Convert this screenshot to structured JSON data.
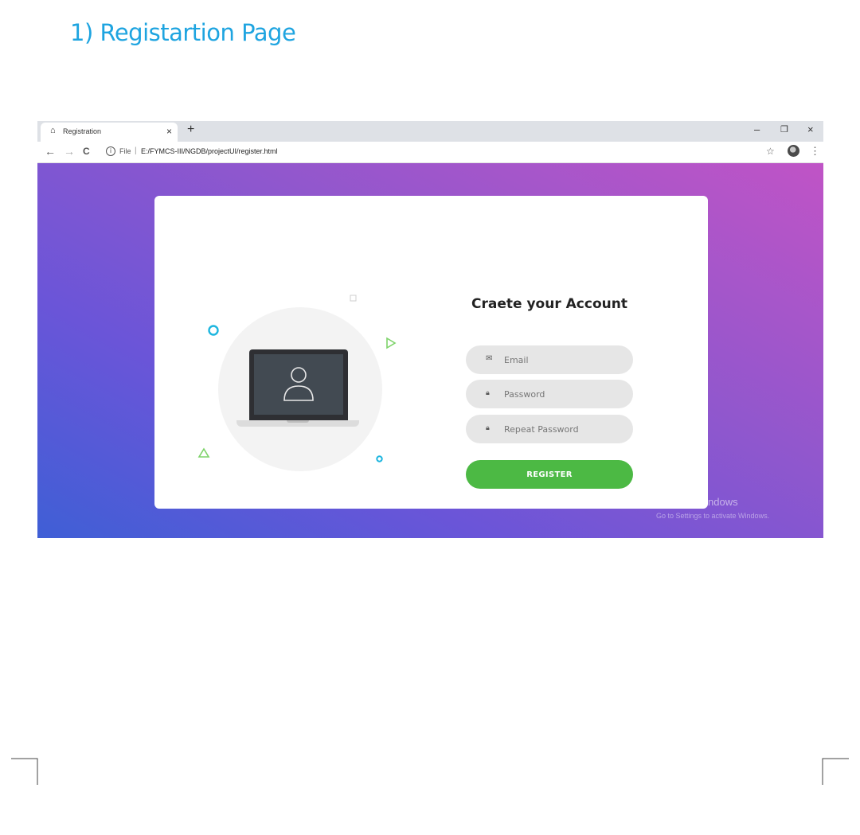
{
  "document": {
    "heading": "1) Registartion Page"
  },
  "browser": {
    "tab": {
      "icon": "home-icon",
      "title": "Registration",
      "close": "×"
    },
    "new_tab": "+",
    "window_controls": {
      "minimize": "–",
      "restore": "❐",
      "close": "×"
    },
    "toolbar": {
      "back": "←",
      "forward": "→",
      "reload": "C",
      "info_icon": "i",
      "scheme_label": "File",
      "separator": "|",
      "url": "E:/FYMCS-III/NGDB/projectUI/register.html",
      "bookmark": "☆",
      "menu": "⋮"
    }
  },
  "page": {
    "form": {
      "title": "Craete your Account",
      "email_placeholder": "Email",
      "password_placeholder": "Password",
      "repeat_password_placeholder": "Repeat Password",
      "register_label": "REGISTER"
    },
    "colors": {
      "gradient_start": "#3f5fd6",
      "gradient_end": "#c054c6",
      "register_button": "#4cb944",
      "deco_cyan": "#1eb6df",
      "deco_green": "#7ed36a"
    }
  },
  "os_watermark": {
    "title": "Activate Windows",
    "subtitle": "Go to Settings to activate Windows."
  }
}
